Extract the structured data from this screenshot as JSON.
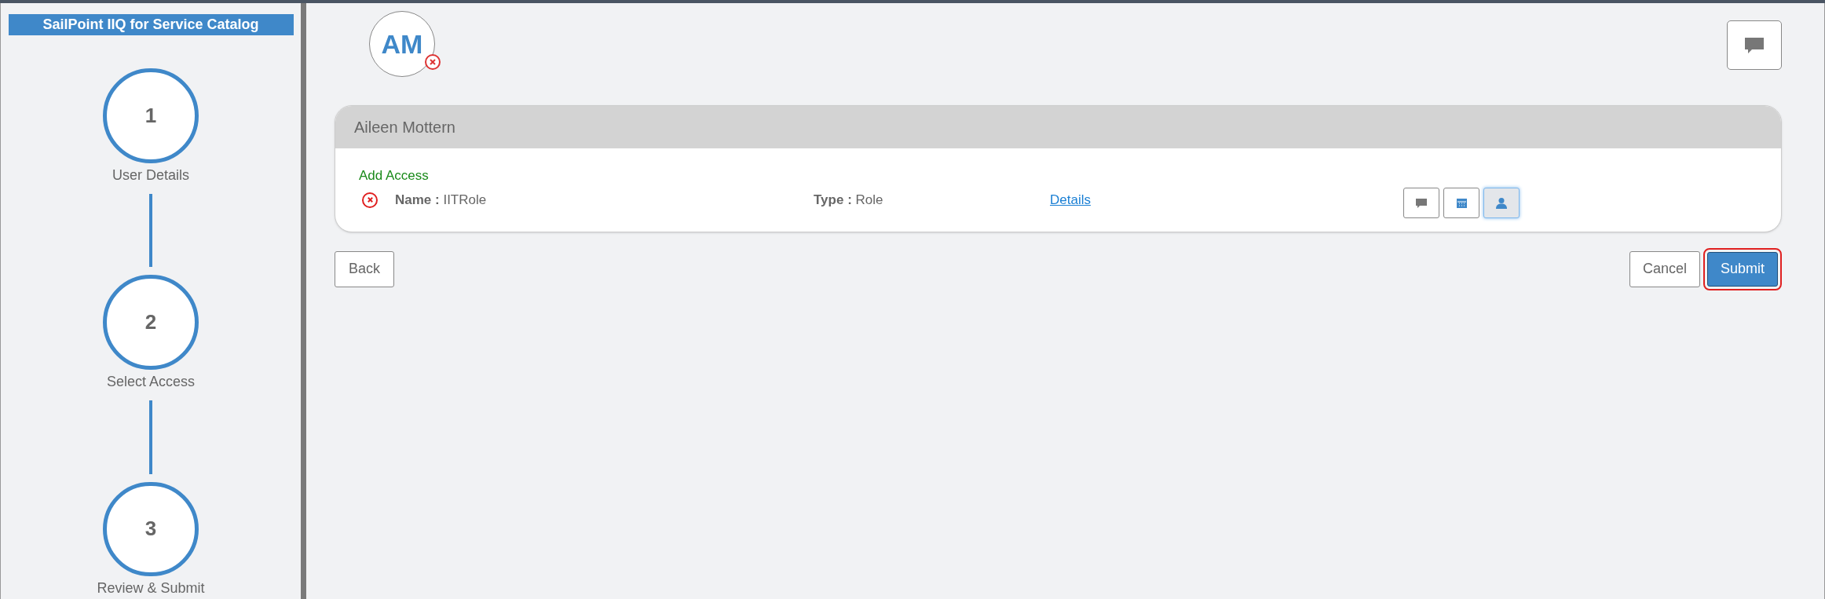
{
  "sidebar": {
    "title": "SailPoint IIQ for Service Catalog",
    "steps": [
      {
        "number": "1",
        "label": "User Details"
      },
      {
        "number": "2",
        "label": "Select Access"
      },
      {
        "number": "3",
        "label": "Review & Submit"
      }
    ]
  },
  "avatar": {
    "initials": "AM"
  },
  "card": {
    "title": "Aileen Mottern",
    "section": "Add Access",
    "items": [
      {
        "name_label": "Name :",
        "name": "IITRole",
        "type_label": "Type :",
        "type": "Role",
        "link": "Details",
        "actions": [
          {
            "kind": "comment",
            "selected": false
          },
          {
            "kind": "calendar",
            "selected": false
          },
          {
            "kind": "person",
            "selected": true
          }
        ]
      }
    ]
  },
  "buttons": {
    "back": "Back",
    "cancel": "Cancel",
    "submit": "Submit"
  }
}
